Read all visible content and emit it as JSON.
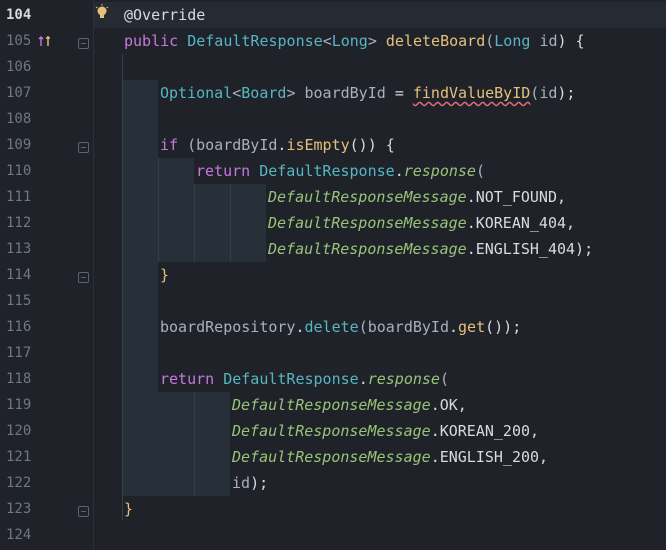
{
  "lines": [
    {
      "num": "104",
      "tokens": [
        {
          "t": "@Override",
          "c": "ann"
        }
      ]
    },
    {
      "num": "105",
      "tokens": [
        {
          "t": "public ",
          "c": "kw"
        },
        {
          "t": "DefaultResponse",
          "c": "ty"
        },
        {
          "t": "<",
          "c": "pm"
        },
        {
          "t": "Long",
          "c": "ty"
        },
        {
          "t": "> ",
          "c": "pm"
        },
        {
          "t": "deleteBoard",
          "c": "fn2"
        },
        {
          "t": "(",
          "c": "pm"
        },
        {
          "t": "Long ",
          "c": "ty"
        },
        {
          "t": "id",
          "c": "pg"
        },
        {
          "t": ") {",
          "c": "cst"
        }
      ]
    },
    {
      "num": "106",
      "tokens": []
    },
    {
      "num": "107",
      "tokens": [
        {
          "t": "Optional",
          "c": "ty"
        },
        {
          "t": "<",
          "c": "pm"
        },
        {
          "t": "Board",
          "c": "ty"
        },
        {
          "t": "> ",
          "c": "pm"
        },
        {
          "t": "boardById ",
          "c": "pg"
        },
        {
          "t": "= ",
          "c": "cst"
        },
        {
          "t": "findValueByID",
          "c": "fn2 squiggle"
        },
        {
          "t": "(",
          "c": "pm"
        },
        {
          "t": "id",
          "c": "pg"
        },
        {
          "t": ");",
          "c": "cst"
        }
      ]
    },
    {
      "num": "108",
      "tokens": []
    },
    {
      "num": "109",
      "tokens": [
        {
          "t": "if ",
          "c": "kw"
        },
        {
          "t": "(",
          "c": "pm"
        },
        {
          "t": "boardById",
          "c": "pg"
        },
        {
          "t": ".",
          "c": "cst"
        },
        {
          "t": "isEmpty",
          "c": "fn2"
        },
        {
          "t": "()) {",
          "c": "cst"
        }
      ]
    },
    {
      "num": "110",
      "tokens": [
        {
          "t": "return ",
          "c": "kw"
        },
        {
          "t": "DefaultResponse",
          "c": "ty"
        },
        {
          "t": ".",
          "c": "cst"
        },
        {
          "t": "response",
          "c": "it"
        },
        {
          "t": "(",
          "c": "pm"
        }
      ]
    },
    {
      "num": "111",
      "tokens": [
        {
          "t": "DefaultResponseMessage",
          "c": "it"
        },
        {
          "t": ".NOT_FOUND,",
          "c": "cst"
        }
      ]
    },
    {
      "num": "112",
      "tokens": [
        {
          "t": "DefaultResponseMessage",
          "c": "it"
        },
        {
          "t": ".KOREAN_404,",
          "c": "cst"
        }
      ]
    },
    {
      "num": "113",
      "tokens": [
        {
          "t": "DefaultResponseMessage",
          "c": "it"
        },
        {
          "t": ".ENGLISH_404);",
          "c": "cst"
        }
      ]
    },
    {
      "num": "114",
      "tokens": [
        {
          "t": "}",
          "c": "fn2"
        }
      ]
    },
    {
      "num": "115",
      "tokens": []
    },
    {
      "num": "116",
      "tokens": [
        {
          "t": "boardRepository",
          "c": "pg"
        },
        {
          "t": ".",
          "c": "cst"
        },
        {
          "t": "delete",
          "c": "ty"
        },
        {
          "t": "(",
          "c": "pm"
        },
        {
          "t": "boardById",
          "c": "pg"
        },
        {
          "t": ".",
          "c": "cst"
        },
        {
          "t": "get",
          "c": "fn2"
        },
        {
          "t": "());",
          "c": "cst"
        }
      ]
    },
    {
      "num": "117",
      "tokens": []
    },
    {
      "num": "118",
      "tokens": [
        {
          "t": "return ",
          "c": "kw"
        },
        {
          "t": "DefaultResponse",
          "c": "ty"
        },
        {
          "t": ".",
          "c": "cst"
        },
        {
          "t": "response",
          "c": "it"
        },
        {
          "t": "(",
          "c": "pm"
        }
      ]
    },
    {
      "num": "119",
      "tokens": [
        {
          "t": "DefaultResponseMessage",
          "c": "it"
        },
        {
          "t": ".OK,",
          "c": "cst"
        }
      ]
    },
    {
      "num": "120",
      "tokens": [
        {
          "t": "DefaultResponseMessage",
          "c": "it"
        },
        {
          "t": ".KOREAN_200,",
          "c": "cst"
        }
      ]
    },
    {
      "num": "121",
      "tokens": [
        {
          "t": "DefaultResponseMessage",
          "c": "it"
        },
        {
          "t": ".ENGLISH_200,",
          "c": "cst"
        }
      ]
    },
    {
      "num": "122",
      "tokens": [
        {
          "t": "id",
          "c": "pg"
        },
        {
          "t": ");",
          "c": "cst"
        }
      ]
    },
    {
      "num": "123",
      "tokens": [
        {
          "t": "}",
          "c": "fn2"
        }
      ]
    },
    {
      "num": "124",
      "tokens": []
    }
  ],
  "icons": {
    "line_104": "lightbulb-icon",
    "line_105": "override-method-icon"
  }
}
